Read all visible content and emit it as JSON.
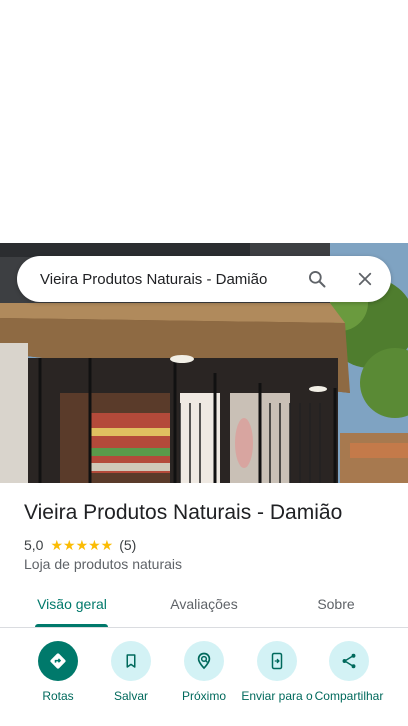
{
  "search": {
    "query": "Vieira Produtos Naturais - Damião"
  },
  "place": {
    "name": "Vieira Produtos Naturais - Damião",
    "rating": "5,0",
    "stars": "★★★★★",
    "review_count": "(5)",
    "category": "Loja de produtos naturais"
  },
  "tabs": [
    {
      "label": "Visão geral",
      "active": true
    },
    {
      "label": "Avaliações",
      "active": false
    },
    {
      "label": "Sobre",
      "active": false
    }
  ],
  "actions": [
    {
      "label": "Rotas",
      "icon": "directions-icon"
    },
    {
      "label": "Salvar",
      "icon": "bookmark-icon"
    },
    {
      "label": "Próximo",
      "icon": "nearby-icon"
    },
    {
      "label": "Enviar para o",
      "icon": "send-to-phone-icon"
    },
    {
      "label": "Compartilhar",
      "icon": "share-icon"
    }
  ],
  "colors": {
    "accent": "#00796b",
    "action_bg": "#d3f2f5",
    "star": "#fbbc04",
    "text": "#202124",
    "muted": "#5f6368"
  }
}
